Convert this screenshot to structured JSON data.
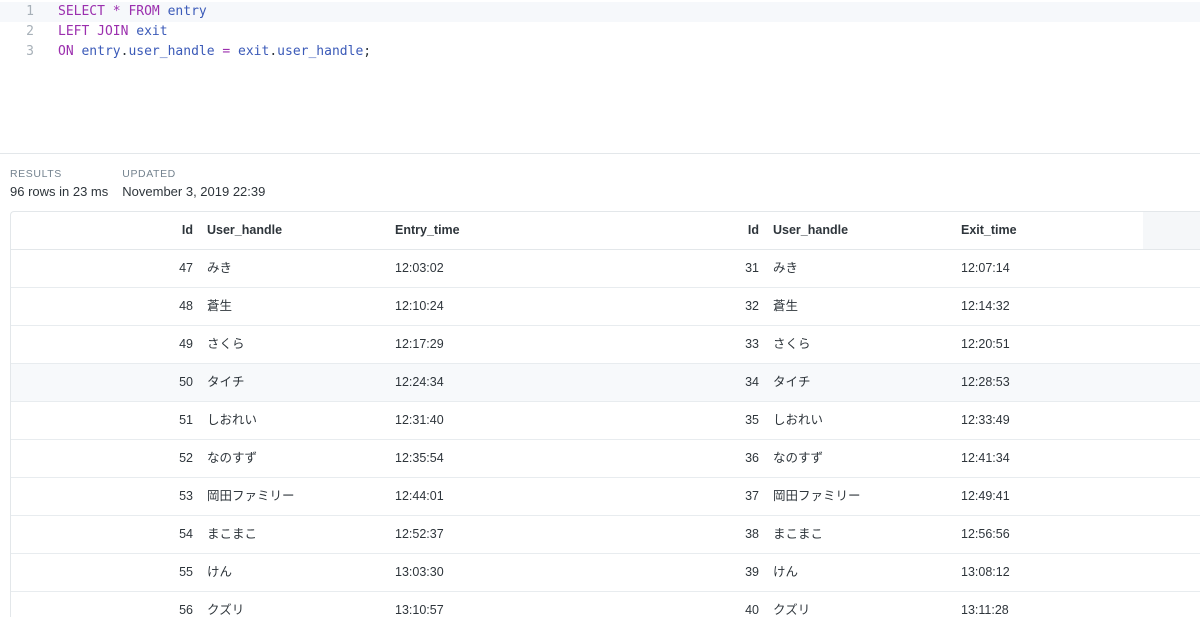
{
  "editor": {
    "lines": [
      {
        "num": "1",
        "tokens": [
          [
            "kw",
            "SELECT"
          ],
          [
            "plain",
            " "
          ],
          [
            "op",
            "*"
          ],
          [
            "plain",
            " "
          ],
          [
            "kw",
            "FROM"
          ],
          [
            "plain",
            " "
          ],
          [
            "ident",
            "entry"
          ]
        ]
      },
      {
        "num": "2",
        "tokens": [
          [
            "kw",
            "LEFT"
          ],
          [
            "plain",
            " "
          ],
          [
            "kw",
            "JOIN"
          ],
          [
            "plain",
            " "
          ],
          [
            "ident",
            "exit"
          ]
        ]
      },
      {
        "num": "3",
        "tokens": [
          [
            "kw",
            "ON"
          ],
          [
            "plain",
            " "
          ],
          [
            "ident",
            "entry"
          ],
          [
            "plain",
            "."
          ],
          [
            "ident",
            "user_handle"
          ],
          [
            "plain",
            " "
          ],
          [
            "op",
            "="
          ],
          [
            "plain",
            " "
          ],
          [
            "ident",
            "exit"
          ],
          [
            "plain",
            "."
          ],
          [
            "ident",
            "user_handle"
          ],
          [
            "plain",
            ";"
          ]
        ]
      }
    ]
  },
  "meta": {
    "results_label": "RESULTS",
    "results_value": "96 rows in 23 ms",
    "updated_label": "UPDATED",
    "updated_value": "November 3, 2019 22:39"
  },
  "table": {
    "columns": [
      "Id",
      "User_handle",
      "Entry_time",
      "Id",
      "User_handle",
      "Exit_time"
    ],
    "rows": [
      [
        "47",
        "みき",
        "12:03:02",
        "31",
        "みき",
        "12:07:14"
      ],
      [
        "48",
        "蒼生",
        "12:10:24",
        "32",
        "蒼生",
        "12:14:32"
      ],
      [
        "49",
        "さくら",
        "12:17:29",
        "33",
        "さくら",
        "12:20:51"
      ],
      [
        "50",
        "タイチ",
        "12:24:34",
        "34",
        "タイチ",
        "12:28:53"
      ],
      [
        "51",
        "しおれい",
        "12:31:40",
        "35",
        "しおれい",
        "12:33:49"
      ],
      [
        "52",
        "なのすず",
        "12:35:54",
        "36",
        "なのすず",
        "12:41:34"
      ],
      [
        "53",
        "岡田ファミリー",
        "12:44:01",
        "37",
        "岡田ファミリー",
        "12:49:41"
      ],
      [
        "54",
        "まこまこ",
        "12:52:37",
        "38",
        "まこまこ",
        "12:56:56"
      ],
      [
        "55",
        "けん",
        "13:03:30",
        "39",
        "けん",
        "13:08:12"
      ],
      [
        "56",
        "クズリ",
        "13:10:57",
        "40",
        "クズリ",
        "13:11:28"
      ]
    ]
  }
}
